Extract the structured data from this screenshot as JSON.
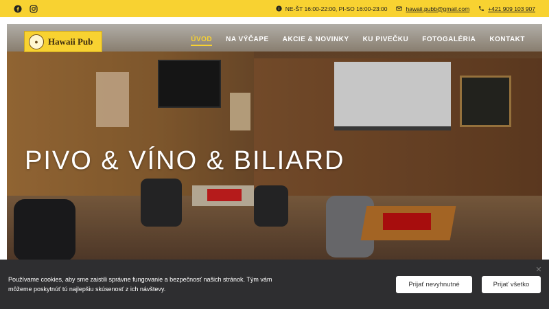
{
  "topbar": {
    "social": [
      {
        "icon": "facebook-icon"
      },
      {
        "icon": "instagram-icon"
      }
    ],
    "hours": "NE-ŠT 16:00-22:00, PI-SO 16:00-23:00",
    "email": "hawaii.pubb@gmail.com",
    "phone": "+421 909 103 907",
    "bg_color": "#f8d231"
  },
  "header": {
    "logo_text": "Hawaii Pub",
    "nav": [
      {
        "label": "ÚVOD",
        "active": true
      },
      {
        "label": "NA VÝČAPE",
        "active": false
      },
      {
        "label": "AKCIE & NOVINKY",
        "active": false
      },
      {
        "label": "KU PIVEČKU",
        "active": false
      },
      {
        "label": "FOTOGALÉRIA",
        "active": false
      },
      {
        "label": "KONTAKT",
        "active": false
      }
    ],
    "accent_color": "#f8d231"
  },
  "hero": {
    "headline": "PIVO & VÍNO & BILIARD"
  },
  "cookie_bar": {
    "text": "Používame cookies, aby sme zaistili správne fungovanie a bezpečnosť našich stránok. Tým vám môžeme poskytnúť tú najlepšiu skúsenosť z ich návštevy.",
    "accept_necessary_label": "Prijať nevyhnutné",
    "accept_all_label": "Prijať všetko",
    "close_icon": "close-icon",
    "bg_color": "#2e2e30"
  }
}
